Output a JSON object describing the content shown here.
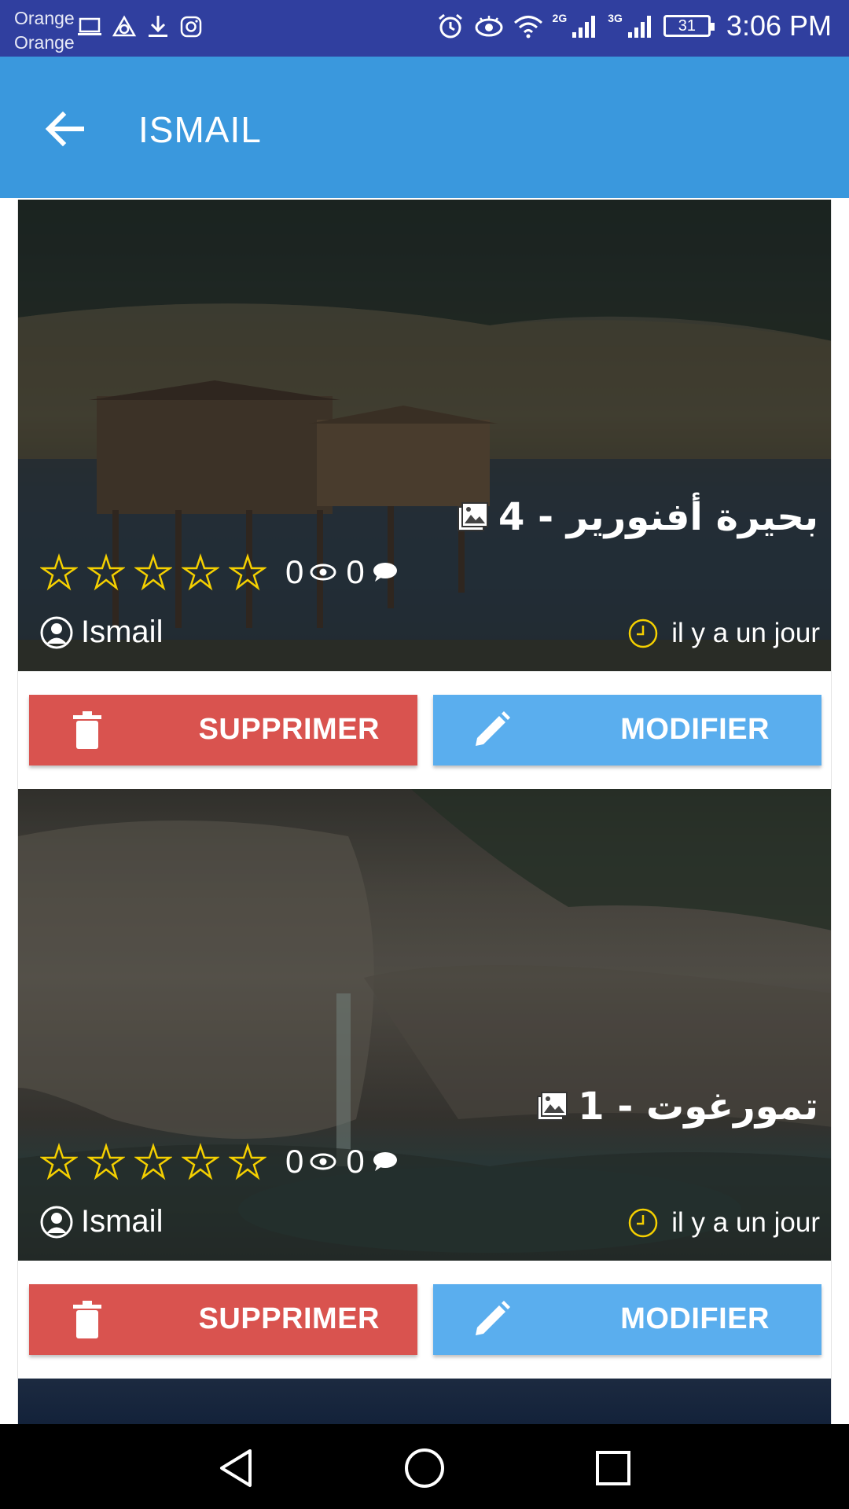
{
  "status_bar": {
    "carrier_line1": "Orange",
    "carrier_line2": "Orange",
    "network_2g": "2G",
    "network_3g": "3G",
    "battery": "31",
    "time": "3:06 PM"
  },
  "app_bar": {
    "title": "ISMAIL"
  },
  "cards": [
    {
      "title": "بحيرة أفنورير - 4",
      "views": "0",
      "comments": "0",
      "author": "Ismail",
      "time": "il y a un jour",
      "rating": 0,
      "delete_label": "SUPPRIMER",
      "edit_label": "MODIFIER"
    },
    {
      "title": "تمورغوت - 1",
      "views": "0",
      "comments": "0",
      "author": "Ismail",
      "time": "il y a un jour",
      "rating": 0,
      "delete_label": "SUPPRIMER",
      "edit_label": "MODIFIER"
    }
  ],
  "colors": {
    "status_bar": "#303f9f",
    "app_bar": "#3a98dd",
    "delete": "#d9534f",
    "edit": "#5aaeee",
    "star": "#f5d000"
  }
}
